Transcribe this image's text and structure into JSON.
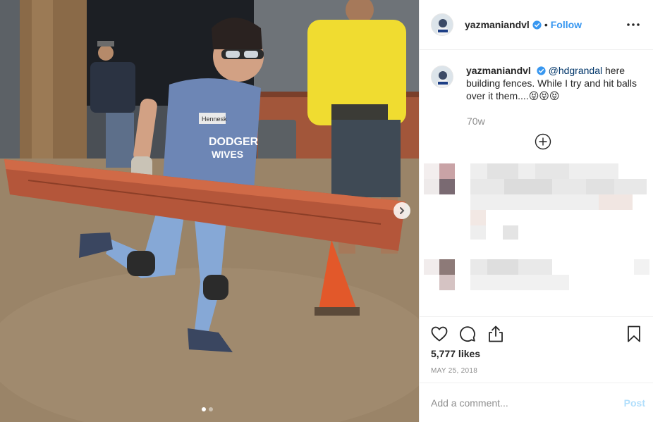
{
  "post": {
    "username": "yazmaniandvl",
    "separator": "•",
    "follow_label": "Follow",
    "caption_mention": "@hdgrandal",
    "caption_text": " here building fences. While I try and hit balls over it them....😝😝😝",
    "caption_time": "70w",
    "likes": "5,777 likes",
    "date": "MAY 25, 2018",
    "comment_placeholder": "Add a comment...",
    "post_label": "Post",
    "photo_text": {
      "shirt_line1": "DODGER",
      "shirt_line2": "WIVES",
      "name_tag": "Hennesk"
    }
  },
  "icons": {
    "verified": "verified-badge-icon",
    "more": "more-options-icon",
    "load_more": "load-more-comments-icon",
    "like": "heart-icon",
    "comment": "comment-bubble-icon",
    "share": "share-icon",
    "save": "bookmark-icon",
    "next": "chevron-right-icon"
  },
  "carousel": {
    "total": 2,
    "active": 1
  },
  "colors": {
    "link": "#3897f0",
    "post_disabled": "#b2dffc",
    "secondary_text": "#8e8e8e",
    "mention": "#003569"
  }
}
